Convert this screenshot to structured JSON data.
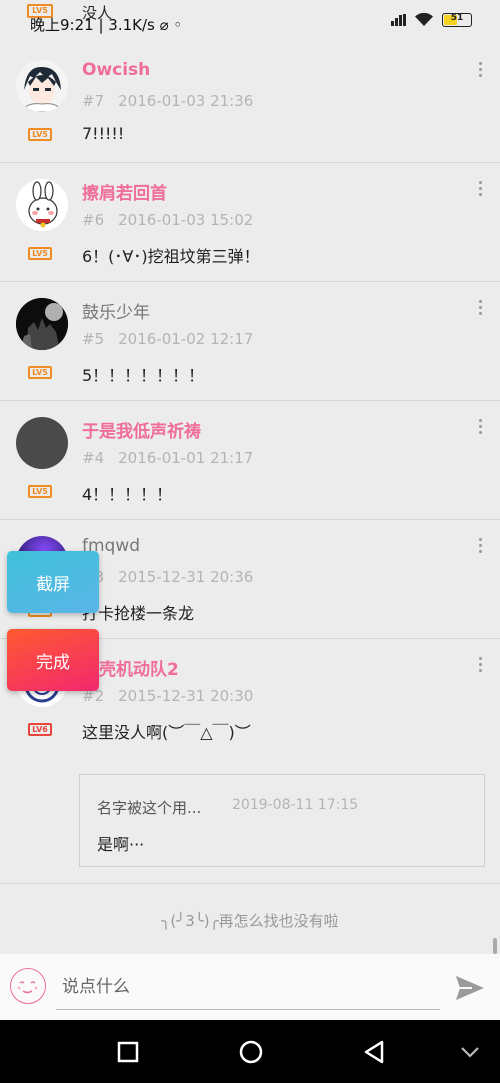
{
  "status_bar": {
    "time_text": "晚上9:21 | 3.1K/s ⌀ ◦",
    "behind_text": "没人",
    "behind_level": "LV5",
    "battery": "51"
  },
  "comments": [
    {
      "name": "Owcish",
      "floor": "#7",
      "date": "2016-01-03 21:36",
      "text": "7!!!!!",
      "level": "LV5",
      "name_style": "pink"
    },
    {
      "name": "擦肩若回首",
      "floor": "#6",
      "date": "2016-01-03 15:02",
      "text": "6！(･∀･)挖祖坟第三弹！",
      "level": "LV5",
      "name_style": "pink"
    },
    {
      "name": "鼓乐少年",
      "floor": "#5",
      "date": "2016-01-02 12:17",
      "text": "5！！！！！！！",
      "level": "LV5",
      "name_style": "grey"
    },
    {
      "name": "于是我低声祈祷",
      "floor": "#4",
      "date": "2016-01-01 21:17",
      "text": "4！！！！！",
      "level": "LV5",
      "name_style": "pink"
    },
    {
      "name": "fmqwd",
      "floor": "#3",
      "date": "2015-12-31 20:36",
      "text": "打卡抢楼一条龙",
      "level": "LV5",
      "name_style": "grey"
    },
    {
      "name": "攻壳机动队2",
      "floor": "#2",
      "date": "2015-12-31 20:30",
      "text": "这里没人啊(︶￣△￣)︶",
      "level": "LV6",
      "name_style": "pink"
    }
  ],
  "reply": {
    "name": "名字被这个用...",
    "date": "2019-08-11 17:15",
    "text": "是啊···"
  },
  "end_text": "╮(╯3╰)╭再怎么找也没有啦",
  "input": {
    "placeholder": "说点什么"
  },
  "floating": {
    "capture": "截屏",
    "done": "完成"
  }
}
